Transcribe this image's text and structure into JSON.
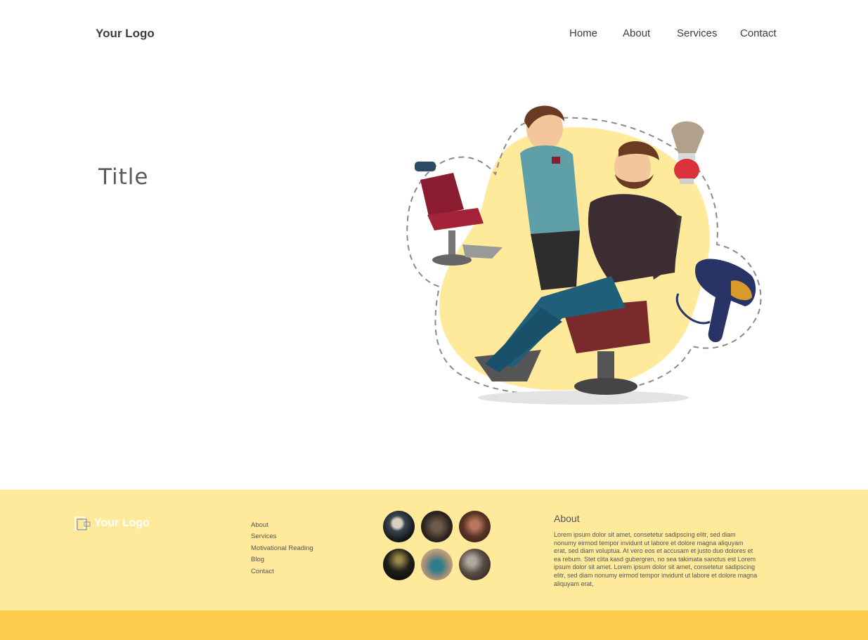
{
  "header": {
    "logo": "Your Logo",
    "nav": [
      {
        "label": "Home"
      },
      {
        "label": "About"
      },
      {
        "label": "Services"
      },
      {
        "label": "Contact"
      }
    ]
  },
  "hero": {
    "title": "Title",
    "illustration_icons": [
      "barber-chair-icon",
      "shaving-brush-icon",
      "hair-dryer-icon"
    ]
  },
  "footer": {
    "logo": "Your Logo",
    "links": [
      {
        "label": "About"
      },
      {
        "label": "Services"
      },
      {
        "label": "Motivational Reading"
      },
      {
        "label": "Blog"
      },
      {
        "label": "Contact"
      }
    ],
    "about_title": "About",
    "about_text": "Lorem ipsum dolor sit amet, consetetur sadipscing elitr, sed diam nonumy eirmod tempor invidunt ut labore et dolore magna aliquyam erat, sed diam voluptua. At vero eos et accusam et justo duo dolores et ea rebum. Stet clita kasd gubergren, no sea takimata sanctus est Lorem ipsum dolor sit amet. Lorem ipsum dolor sit amet, consetetur sadipscing elitr, sed diam nonumy eirmod tempor invidunt ut labore et dolore magna aliquyam erat,"
  },
  "colors": {
    "footer_bg": "#ffe99b",
    "footer_bar": "#ffcd4d",
    "blob": "#ffe99b",
    "text": "#3d3d3d"
  }
}
